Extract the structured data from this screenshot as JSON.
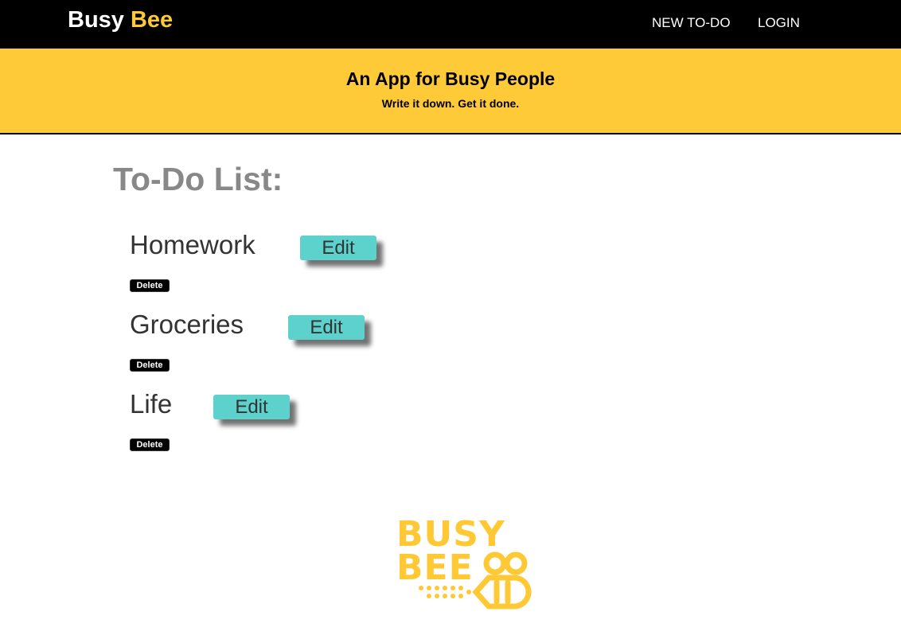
{
  "navbar": {
    "brand_word1": "Busy",
    "brand_word2": "Bee",
    "links": [
      "NEW TO-DO",
      "LOGIN"
    ]
  },
  "hero": {
    "title": "An App for Busy People",
    "subtitle": "Write it down. Get it done."
  },
  "main": {
    "heading": "To-Do List:",
    "todos": [
      {
        "name": "Homework",
        "edit_label": "Edit",
        "delete_label": "Delete"
      },
      {
        "name": "Groceries",
        "edit_label": "Edit",
        "delete_label": "Delete"
      },
      {
        "name": "Life",
        "edit_label": "Edit",
        "delete_label": "Delete"
      }
    ]
  },
  "footer_logo": {
    "line1": "BUSY",
    "line2": "BEE",
    "icon": "bee-icon"
  },
  "colors": {
    "navbar_bg": "#000000",
    "brand_accent": "#ffc935",
    "hero_bg": "#ffca37",
    "edit_button": "#5dd2cd",
    "heading_gray": "#888888"
  }
}
